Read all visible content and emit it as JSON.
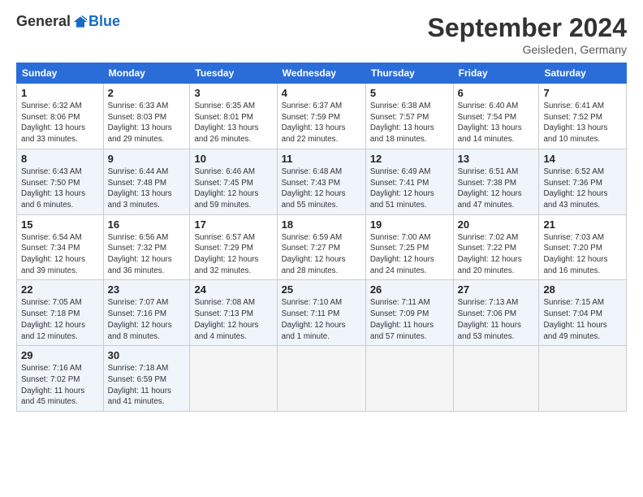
{
  "logo": {
    "general": "General",
    "blue": "Blue"
  },
  "title": "September 2024",
  "location": "Geisleden, Germany",
  "days_of_week": [
    "Sunday",
    "Monday",
    "Tuesday",
    "Wednesday",
    "Thursday",
    "Friday",
    "Saturday"
  ],
  "weeks": [
    [
      {
        "day": "1",
        "sunrise": "6:32 AM",
        "sunset": "8:06 PM",
        "daylight": "13 hours and 33 minutes."
      },
      {
        "day": "2",
        "sunrise": "6:33 AM",
        "sunset": "8:03 PM",
        "daylight": "13 hours and 29 minutes."
      },
      {
        "day": "3",
        "sunrise": "6:35 AM",
        "sunset": "8:01 PM",
        "daylight": "13 hours and 26 minutes."
      },
      {
        "day": "4",
        "sunrise": "6:37 AM",
        "sunset": "7:59 PM",
        "daylight": "13 hours and 22 minutes."
      },
      {
        "day": "5",
        "sunrise": "6:38 AM",
        "sunset": "7:57 PM",
        "daylight": "13 hours and 18 minutes."
      },
      {
        "day": "6",
        "sunrise": "6:40 AM",
        "sunset": "7:54 PM",
        "daylight": "13 hours and 14 minutes."
      },
      {
        "day": "7",
        "sunrise": "6:41 AM",
        "sunset": "7:52 PM",
        "daylight": "13 hours and 10 minutes."
      }
    ],
    [
      {
        "day": "8",
        "sunrise": "6:43 AM",
        "sunset": "7:50 PM",
        "daylight": "13 hours and 6 minutes."
      },
      {
        "day": "9",
        "sunrise": "6:44 AM",
        "sunset": "7:48 PM",
        "daylight": "13 hours and 3 minutes."
      },
      {
        "day": "10",
        "sunrise": "6:46 AM",
        "sunset": "7:45 PM",
        "daylight": "12 hours and 59 minutes."
      },
      {
        "day": "11",
        "sunrise": "6:48 AM",
        "sunset": "7:43 PM",
        "daylight": "12 hours and 55 minutes."
      },
      {
        "day": "12",
        "sunrise": "6:49 AM",
        "sunset": "7:41 PM",
        "daylight": "12 hours and 51 minutes."
      },
      {
        "day": "13",
        "sunrise": "6:51 AM",
        "sunset": "7:38 PM",
        "daylight": "12 hours and 47 minutes."
      },
      {
        "day": "14",
        "sunrise": "6:52 AM",
        "sunset": "7:36 PM",
        "daylight": "12 hours and 43 minutes."
      }
    ],
    [
      {
        "day": "15",
        "sunrise": "6:54 AM",
        "sunset": "7:34 PM",
        "daylight": "12 hours and 39 minutes."
      },
      {
        "day": "16",
        "sunrise": "6:56 AM",
        "sunset": "7:32 PM",
        "daylight": "12 hours and 36 minutes."
      },
      {
        "day": "17",
        "sunrise": "6:57 AM",
        "sunset": "7:29 PM",
        "daylight": "12 hours and 32 minutes."
      },
      {
        "day": "18",
        "sunrise": "6:59 AM",
        "sunset": "7:27 PM",
        "daylight": "12 hours and 28 minutes."
      },
      {
        "day": "19",
        "sunrise": "7:00 AM",
        "sunset": "7:25 PM",
        "daylight": "12 hours and 24 minutes."
      },
      {
        "day": "20",
        "sunrise": "7:02 AM",
        "sunset": "7:22 PM",
        "daylight": "12 hours and 20 minutes."
      },
      {
        "day": "21",
        "sunrise": "7:03 AM",
        "sunset": "7:20 PM",
        "daylight": "12 hours and 16 minutes."
      }
    ],
    [
      {
        "day": "22",
        "sunrise": "7:05 AM",
        "sunset": "7:18 PM",
        "daylight": "12 hours and 12 minutes."
      },
      {
        "day": "23",
        "sunrise": "7:07 AM",
        "sunset": "7:16 PM",
        "daylight": "12 hours and 8 minutes."
      },
      {
        "day": "24",
        "sunrise": "7:08 AM",
        "sunset": "7:13 PM",
        "daylight": "12 hours and 4 minutes."
      },
      {
        "day": "25",
        "sunrise": "7:10 AM",
        "sunset": "7:11 PM",
        "daylight": "12 hours and 1 minute."
      },
      {
        "day": "26",
        "sunrise": "7:11 AM",
        "sunset": "7:09 PM",
        "daylight": "11 hours and 57 minutes."
      },
      {
        "day": "27",
        "sunrise": "7:13 AM",
        "sunset": "7:06 PM",
        "daylight": "11 hours and 53 minutes."
      },
      {
        "day": "28",
        "sunrise": "7:15 AM",
        "sunset": "7:04 PM",
        "daylight": "11 hours and 49 minutes."
      }
    ],
    [
      {
        "day": "29",
        "sunrise": "7:16 AM",
        "sunset": "7:02 PM",
        "daylight": "11 hours and 45 minutes."
      },
      {
        "day": "30",
        "sunrise": "7:18 AM",
        "sunset": "6:59 PM",
        "daylight": "11 hours and 41 minutes."
      },
      null,
      null,
      null,
      null,
      null
    ]
  ]
}
